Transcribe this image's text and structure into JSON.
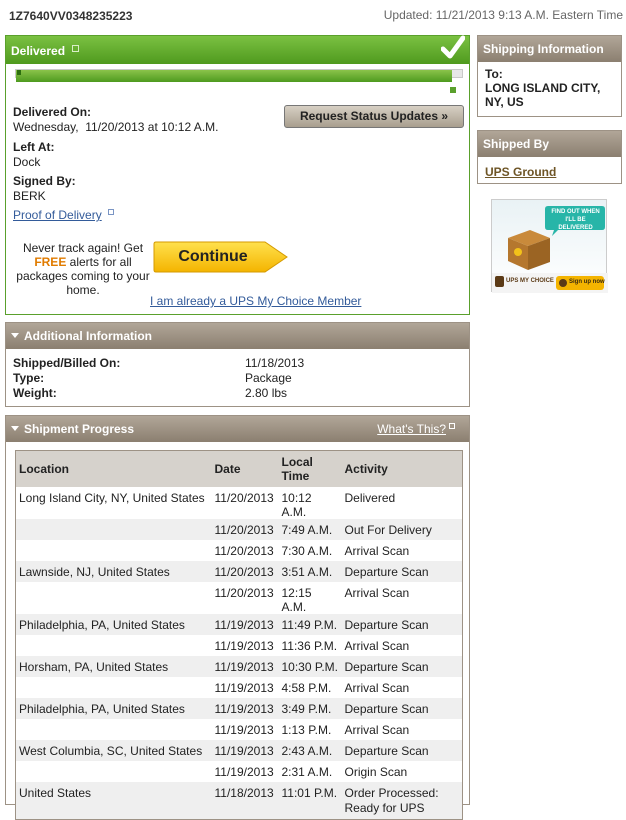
{
  "header": {
    "tracking_number": "1Z7640VV0348235223",
    "updated": "Updated: 11/21/2013 9:13 A.M. Eastern Time"
  },
  "delivered": {
    "title": "Delivered",
    "progress_fraction": 1.0,
    "delivered_on_label": "Delivered On:",
    "delivered_on_value": "Wednesday,  11/20/2013 at 10:12 A.M.",
    "left_at_label": "Left At:",
    "left_at_value": "Dock",
    "signed_by_label": "Signed By:",
    "signed_by_value": "BERK",
    "proof_link": "Proof of Delivery",
    "request_button": "Request Status Updates »",
    "promo_line1": "Never track again! Get",
    "promo_free": "FREE",
    "promo_line2": " alerts for all packages coming to your home.",
    "continue_button": "Continue",
    "member_link": "I am already a UPS My Choice Member"
  },
  "additional": {
    "title": "Additional Information",
    "rows": [
      {
        "label": "Shipped/Billed On:",
        "value": "11/18/2013"
      },
      {
        "label": "Type:",
        "value": "Package"
      },
      {
        "label": "Weight:",
        "value": "2.80 lbs"
      }
    ]
  },
  "progress": {
    "title": "Shipment Progress",
    "whats_this": "What's This?",
    "columns": {
      "location": "Location",
      "date": "Date",
      "time": "Local Time",
      "activity": "Activity"
    },
    "rows": [
      {
        "location": "Long Island City, NY, United States",
        "date": "11/20/2013",
        "time": "10:12 A.M.",
        "activity": "Delivered"
      },
      {
        "location": "",
        "date": "11/20/2013",
        "time": "7:49 A.M.",
        "activity": "Out For Delivery"
      },
      {
        "location": "",
        "date": "11/20/2013",
        "time": "7:30 A.M.",
        "activity": "Arrival Scan"
      },
      {
        "location": "Lawnside, NJ, United States",
        "date": "11/20/2013",
        "time": "3:51 A.M.",
        "activity": "Departure Scan"
      },
      {
        "location": "",
        "date": "11/20/2013",
        "time": "12:15 A.M.",
        "activity": "Arrival Scan"
      },
      {
        "location": "Philadelphia, PA, United States",
        "date": "11/19/2013",
        "time": "11:49 P.M.",
        "activity": "Departure Scan"
      },
      {
        "location": "",
        "date": "11/19/2013",
        "time": "11:36 P.M.",
        "activity": "Arrival Scan"
      },
      {
        "location": "Horsham, PA, United States",
        "date": "11/19/2013",
        "time": "10:30 P.M.",
        "activity": "Departure Scan"
      },
      {
        "location": "",
        "date": "11/19/2013",
        "time": "4:58 P.M.",
        "activity": "Arrival Scan"
      },
      {
        "location": "Philadelphia, PA, United States",
        "date": "11/19/2013",
        "time": "3:49 P.M.",
        "activity": "Departure Scan"
      },
      {
        "location": "",
        "date": "11/19/2013",
        "time": "1:13 P.M.",
        "activity": "Arrival Scan"
      },
      {
        "location": "West Columbia, SC, United States",
        "date": "11/19/2013",
        "time": "2:43 A.M.",
        "activity": "Departure Scan"
      },
      {
        "location": "",
        "date": "11/19/2013",
        "time": "2:31 A.M.",
        "activity": "Origin Scan"
      },
      {
        "location": "United States",
        "date": "11/18/2013",
        "time": "11:01 P.M.",
        "activity": "Order Processed: Ready for UPS"
      }
    ]
  },
  "shipping_info": {
    "title": "Shipping Information",
    "to_label": "To:",
    "to_value": "LONG ISLAND CITY, NY, US"
  },
  "shipped_by": {
    "title": "Shipped By",
    "service": "UPS Ground"
  },
  "ad": {
    "bubble": "FIND OUT WHEN I'LL BE DELIVERED",
    "brand": "UPS MY CHOICE",
    "signup": "Sign up now"
  },
  "colors": {
    "delivered_green": "#5aa02c",
    "ups_brown": "#8b7f70",
    "link_blue": "#335b9a",
    "promo_orange": "#e07b00"
  }
}
